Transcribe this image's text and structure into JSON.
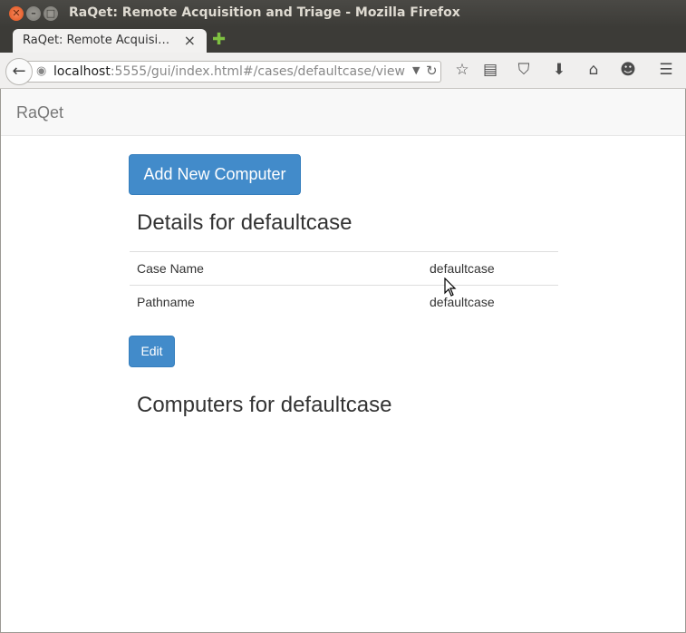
{
  "window": {
    "title": "RaQet: Remote Acquisition and Triage - Mozilla Firefox"
  },
  "tab": {
    "label": "RaQet: Remote Acquisi…"
  },
  "urlbar": {
    "host": "localhost",
    "rest": ":5555/gui/index.html#/cases/defaultcase/view"
  },
  "app": {
    "brand": "RaQet",
    "add_button": "Add New Computer",
    "details_heading": "Details for defaultcase",
    "details": [
      {
        "label": "Case Name",
        "value": "defaultcase"
      },
      {
        "label": "Pathname",
        "value": "defaultcase"
      }
    ],
    "edit_button": "Edit",
    "computers_heading": "Computers for defaultcase"
  },
  "colors": {
    "primary": "#428bca",
    "navbar_bg": "#f8f8f8",
    "brand_text": "#777777"
  }
}
